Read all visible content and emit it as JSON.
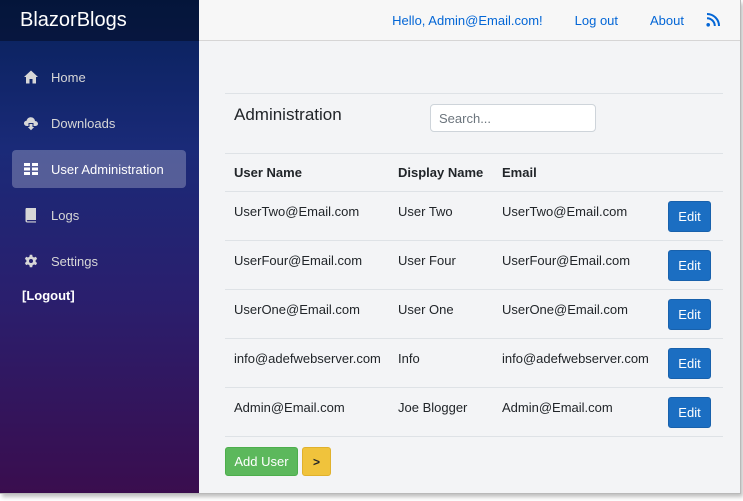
{
  "app": {
    "brand": "BlazorBlogs"
  },
  "sidebar": {
    "items": [
      {
        "label": "Home",
        "icon": "home-icon"
      },
      {
        "label": "Downloads",
        "icon": "cloud-download-icon"
      },
      {
        "label": "User Administration",
        "icon": "list-icon",
        "active": true
      },
      {
        "label": "Logs",
        "icon": "book-icon"
      },
      {
        "label": "Settings",
        "icon": "gear-icon"
      }
    ],
    "logout": "[Logout]"
  },
  "topbar": {
    "greeting": "Hello, Admin@Email.com!",
    "logout": "Log out",
    "about": "About",
    "rss_icon": "rss-icon"
  },
  "main": {
    "title": "Administration",
    "search_placeholder": "Search...",
    "columns": [
      "User Name",
      "Display Name",
      "Email"
    ],
    "rows": [
      {
        "user_name": "UserTwo@Email.com",
        "display_name": "User Two",
        "email": "UserTwo@Email.com",
        "action": "Edit"
      },
      {
        "user_name": "UserFour@Email.com",
        "display_name": "User Four",
        "email": "UserFour@Email.com",
        "action": "Edit"
      },
      {
        "user_name": "UserOne@Email.com",
        "display_name": "User One",
        "email": "UserOne@Email.com",
        "action": "Edit"
      },
      {
        "user_name": "info@adefwebserver.com",
        "display_name": "Info",
        "email": "info@adefwebserver.com",
        "action": "Edit"
      },
      {
        "user_name": "Admin@Email.com",
        "display_name": "Joe Blogger",
        "email": "Admin@Email.com",
        "action": "Edit"
      }
    ],
    "add_user": "Add User",
    "next": ">"
  },
  "colors": {
    "accent": "#1b6ec2",
    "link": "#0366d6",
    "add": "#5cb85c",
    "next": "#f0c33c"
  }
}
